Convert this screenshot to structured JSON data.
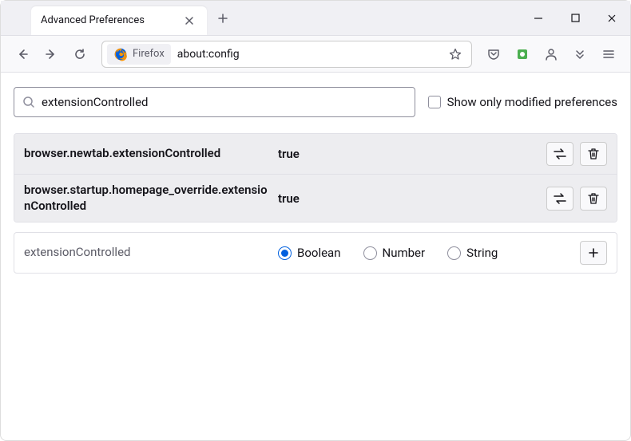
{
  "window": {
    "tab_title": "Advanced Preferences"
  },
  "urlbar": {
    "identity": "Firefox",
    "url": "about:config"
  },
  "search": {
    "value": "extensionControlled",
    "checkbox_label": "Show only modified preferences"
  },
  "prefs": [
    {
      "name": "browser.newtab.extensionControlled",
      "value": "true"
    },
    {
      "name": "browser.startup.homepage_override.extensionControlled",
      "value": "true"
    }
  ],
  "newpref": {
    "name": "extensionControlled",
    "types": [
      "Boolean",
      "Number",
      "String"
    ],
    "selected": 0
  }
}
